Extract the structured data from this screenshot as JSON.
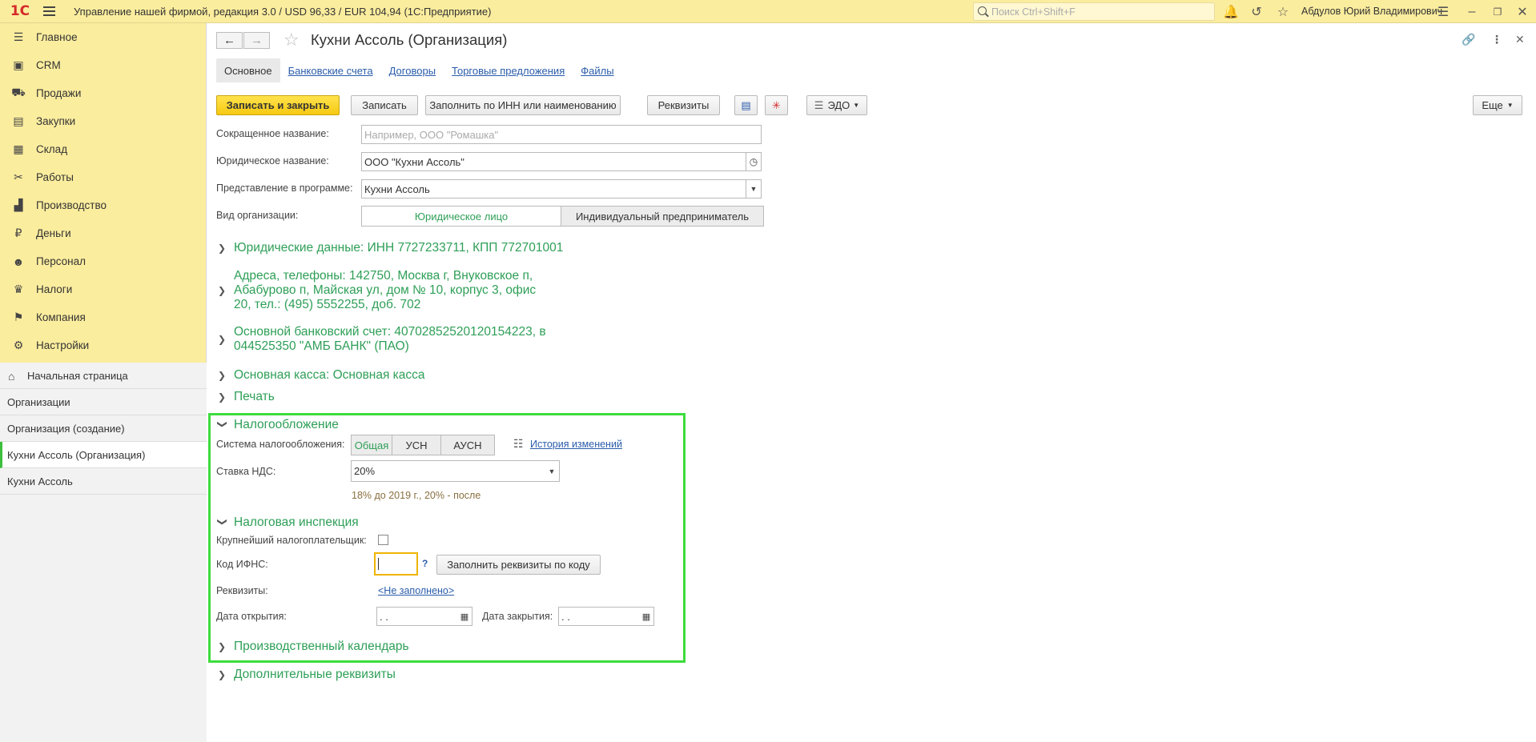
{
  "app": {
    "logo": "1С",
    "title": "Управление нашей фирмой, редакция 3.0 / USD 96,33 / EUR 104,94  (1С:Предприятие)",
    "search_placeholder": "Поиск Ctrl+Shift+F",
    "user": "Абдулов Юрий Владимирович"
  },
  "sidebar": {
    "items": [
      {
        "label": "Главное",
        "icon": "menu-lines-icon"
      },
      {
        "label": "CRM",
        "icon": "contacts-icon"
      },
      {
        "label": "Продажи",
        "icon": "basket-icon"
      },
      {
        "label": "Закупки",
        "icon": "purchases-icon"
      },
      {
        "label": "Склад",
        "icon": "warehouse-icon"
      },
      {
        "label": "Работы",
        "icon": "tools-icon"
      },
      {
        "label": "Производство",
        "icon": "factory-icon"
      },
      {
        "label": "Деньги",
        "icon": "ruble-icon"
      },
      {
        "label": "Персонал",
        "icon": "people-icon"
      },
      {
        "label": "Налоги",
        "icon": "emblem-icon"
      },
      {
        "label": "Компания",
        "icon": "flag-icon"
      },
      {
        "label": "Настройки",
        "icon": "gear-icon"
      }
    ],
    "open_windows": [
      {
        "label": "Начальная страница"
      },
      {
        "label": "Организации"
      },
      {
        "label": "Организация (создание)"
      },
      {
        "label": "Кухни Ассоль (Организация)"
      },
      {
        "label": "Кухни Ассоль"
      }
    ]
  },
  "form": {
    "title": "Кухни Ассоль (Организация)",
    "tabs": [
      "Основное",
      "Банковские счета",
      "Договоры",
      "Торговые предложения",
      "Файлы"
    ],
    "toolbar": {
      "save_close": "Записать и закрыть",
      "save": "Записать",
      "fill_inn": "Заполнить по ИНН или наименованию",
      "requisites": "Реквизиты",
      "edo": "ЭДО",
      "more": "Еще"
    },
    "fields": {
      "short_name_label": "Сокращенное название:",
      "short_name_placeholder": "Например, ООО \"Ромашка\"",
      "legal_name_label": "Юридическое название:",
      "legal_name_value": "ООО \"Кухни Ассоль\"",
      "display_label": "Представление в программе:",
      "display_value": "Кухни Ассоль",
      "org_type_label": "Вид организации:",
      "org_type_legal": "Юридическое лицо",
      "org_type_individual": "Индивидуальный предприниматель"
    },
    "groups": {
      "legal": "Юридические данные: ИНН 7727233711, КПП 772701001",
      "address_line1": "Адреса, телефоны: 142750, Москва г, Внуковское п,",
      "address_line2": "Абабурово п, Майская ул, дом № 10, корпус 3, офис",
      "address_line3": "20, тел.: (495) 5552255, доб. 702",
      "bank_line1": "Основной банковский счет: 40702852520120154223, в",
      "bank_line2": "044525350 \"АМБ БАНК\" (ПАО)",
      "cash": "Основная касса: Основная касса",
      "print": "Печать",
      "taxation": "Налогообложение",
      "tax_inspection": "Налоговая инспекция",
      "calendar": "Производственный календарь",
      "extra": "Дополнительные реквизиты"
    },
    "taxation": {
      "system_label": "Система налогообложения:",
      "systems": [
        "Общая",
        "УСН",
        "АУСН"
      ],
      "history_link": "История изменений",
      "vat_label": "Ставка НДС:",
      "vat_value": "20%",
      "vat_hint": "18% до 2019 г., 20% - после"
    },
    "inspection": {
      "largest_label": "Крупнейший налогоплательщик:",
      "ifns_label": "Код ИФНС:",
      "ifns_help": "?",
      "fill_by_code": "Заполнить реквизиты по коду",
      "requisites_label": "Реквизиты:",
      "requisites_link": "<Не заполнено>",
      "open_date_label": "Дата открытия:",
      "open_date_value": " .  .",
      "close_date_label": "Дата закрытия:",
      "close_date_value": " .  ."
    }
  },
  "colors": {
    "panel_yellow": "#fbed9e",
    "group_green": "#2e9f57",
    "highlight_frame": "#3ddc3d",
    "link_blue": "#2a5caa"
  }
}
